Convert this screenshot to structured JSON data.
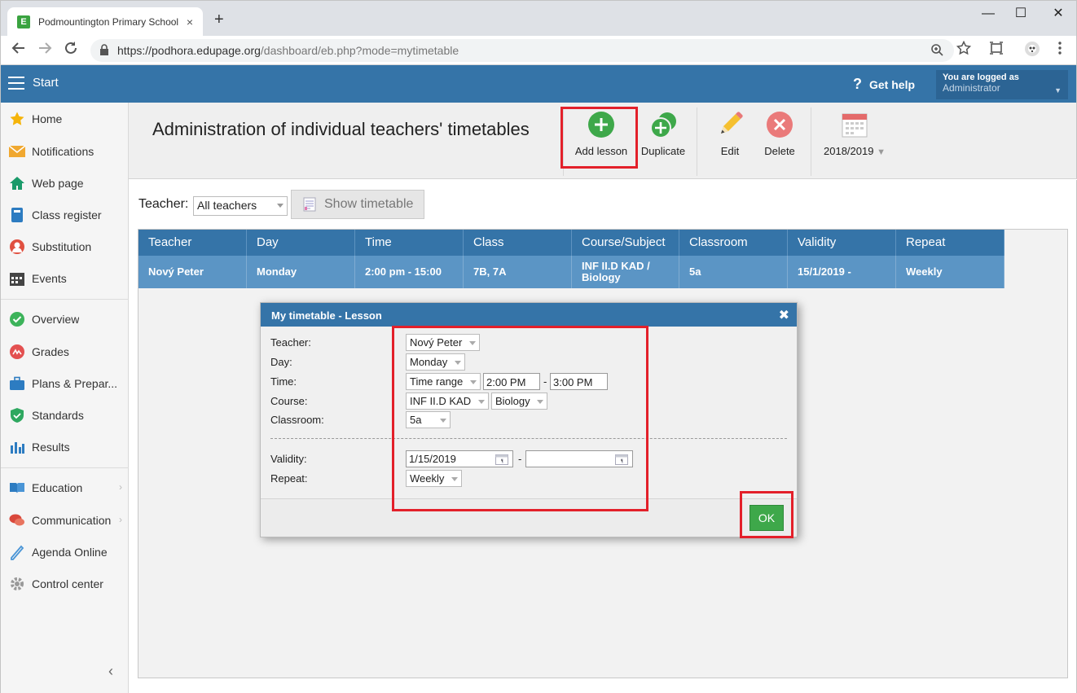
{
  "browser": {
    "tab_title": "Podmountington Primary School",
    "tab_close": "×",
    "new_tab": "+",
    "url_host": "https://podhora.edupage.org",
    "url_path": "/dashboard/eb.php?mode=mytimetable",
    "win_min": "—",
    "win_max": "☐",
    "win_close": "✕"
  },
  "header": {
    "start_label": "Start",
    "help_label": "Get help",
    "help_glyph": "?",
    "user_line1": "You are logged as",
    "user_line2": "Administrator"
  },
  "sidebar": {
    "items": [
      {
        "label": "Home",
        "icon": "star-icon"
      },
      {
        "label": "Notifications",
        "icon": "envelope-icon"
      },
      {
        "label": "Web page",
        "icon": "house-icon"
      },
      {
        "label": "Class register",
        "icon": "book-icon"
      },
      {
        "label": "Substitution",
        "icon": "person-icon"
      },
      {
        "label": "Events",
        "icon": "calendar-icon"
      },
      {
        "label": "Overview",
        "icon": "check-circle-icon"
      },
      {
        "label": "Grades",
        "icon": "grades-icon"
      },
      {
        "label": "Plans & Prepar...",
        "icon": "briefcase-icon"
      },
      {
        "label": "Standards",
        "icon": "shield-check-icon"
      },
      {
        "label": "Results",
        "icon": "bar-chart-icon"
      },
      {
        "label": "Education",
        "icon": "open-book-icon"
      },
      {
        "label": "Communication",
        "icon": "chat-icon"
      },
      {
        "label": "Agenda Online",
        "icon": "pen-icon"
      },
      {
        "label": "Control center",
        "icon": "gear-icon"
      }
    ],
    "collapse_glyph": "‹"
  },
  "toolbar": {
    "page_title": "Administration of individual teachers' timetables",
    "add_lesson": "Add lesson",
    "duplicate": "Duplicate",
    "edit": "Edit",
    "delete": "Delete",
    "year": "2018/2019"
  },
  "filter": {
    "teacher_label": "Teacher:",
    "teacher_value": "All teachers",
    "show_button": "Show timetable"
  },
  "grid": {
    "columns": [
      "Teacher",
      "Day",
      "Time",
      "Class",
      "Course/Subject",
      "Classroom",
      "Validity",
      "Repeat"
    ],
    "rows": [
      [
        "Nový Peter",
        "Monday",
        "2:00 pm - 15:00",
        "7B, 7A",
        "INF II.D KAD / Biology",
        "5a",
        "15/1/2019 -",
        "Weekly"
      ]
    ]
  },
  "dialog": {
    "title": "My timetable - Lesson",
    "close_glyph": "✖",
    "labels": {
      "teacher": "Teacher:",
      "day": "Day:",
      "time": "Time:",
      "course": "Course:",
      "classroom": "Classroom:",
      "validity": "Validity:",
      "repeat": "Repeat:"
    },
    "teacher": "Nový Peter",
    "day": "Monday",
    "time_mode": "Time range",
    "time_from": "2:00 PM",
    "time_to": "3:00 PM",
    "course": "INF II.D KAD",
    "subject": "Biology",
    "classroom": "5a",
    "validity_from": "1/15/2019",
    "validity_to": "",
    "repeat": "Weekly",
    "range_dash": "-",
    "ok_label": "OK"
  },
  "colors": {
    "brand_blue": "#3574a8",
    "row_blue": "#5b95c5",
    "highlight_red": "#e3202a",
    "ok_green": "#3ea84a"
  }
}
